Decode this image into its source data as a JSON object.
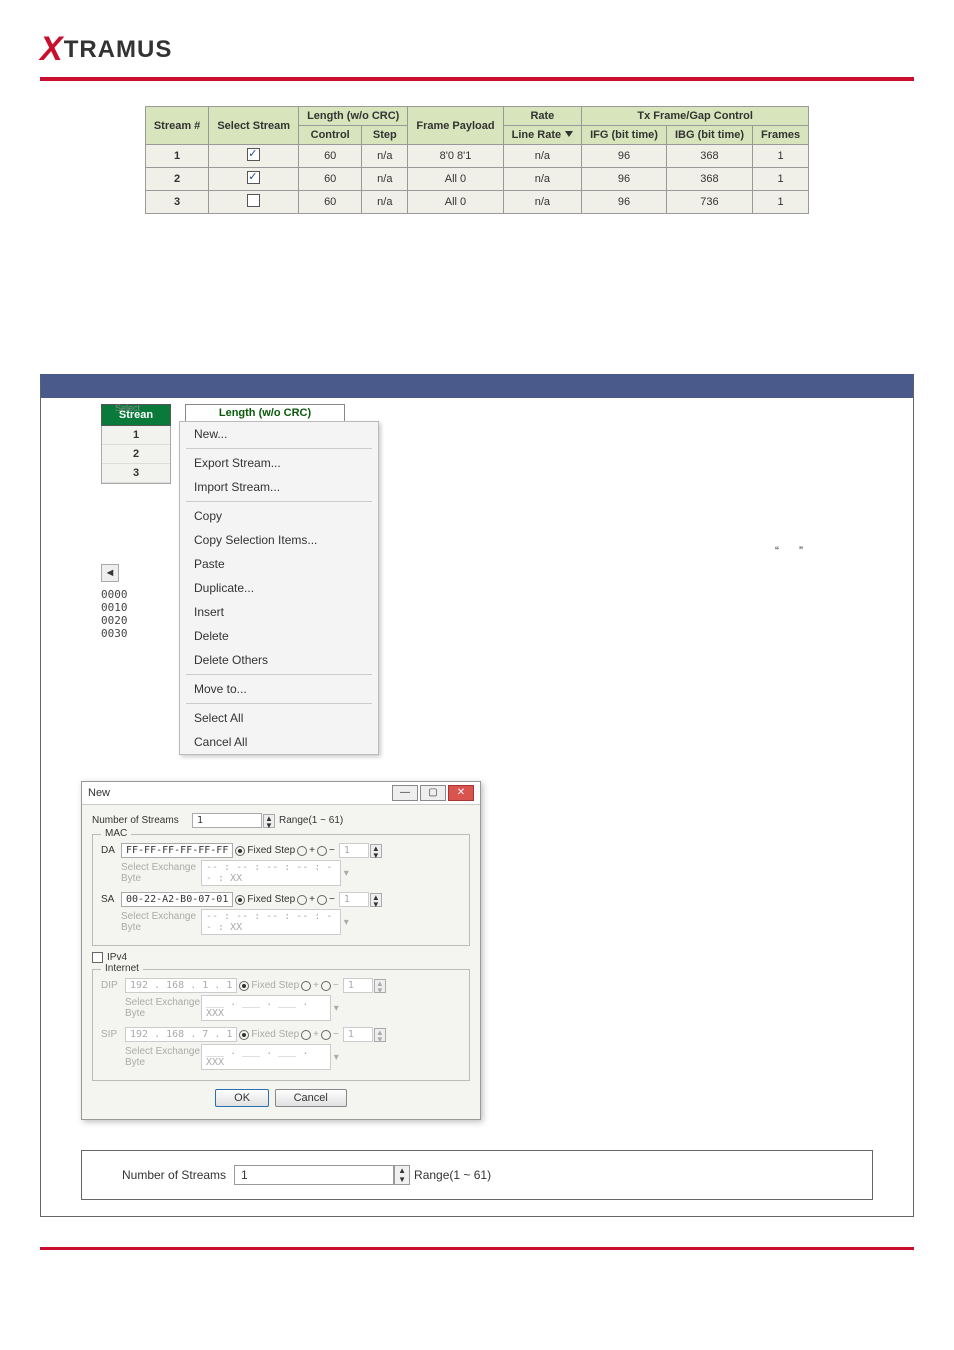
{
  "logo": {
    "x": "X",
    "rest": "TRAMUS"
  },
  "stream_table": {
    "headers": {
      "stream_no": "Stream #",
      "select_stream": "Select Stream",
      "length_group": "Length (w/o CRC)",
      "control": "Control",
      "step": "Step",
      "frame_payload": "Frame Payload",
      "rate": "Rate",
      "line_rate": "Line Rate",
      "tx_group": "Tx Frame/Gap Control",
      "ifg": "IFG (bit time)",
      "ibg": "IBG (bit time)",
      "frames": "Frames"
    },
    "rows": [
      {
        "num": "1",
        "checked": true,
        "control": "60",
        "step": "n/a",
        "payload": "8'0 8'1",
        "rate": "n/a",
        "ifg": "96",
        "ibg": "368",
        "frames": "1"
      },
      {
        "num": "2",
        "checked": true,
        "control": "60",
        "step": "n/a",
        "payload": "All 0",
        "rate": "n/a",
        "ifg": "96",
        "ibg": "368",
        "frames": "1"
      },
      {
        "num": "3",
        "checked": false,
        "control": "60",
        "step": "n/a",
        "payload": "All 0",
        "rate": "n/a",
        "ifg": "96",
        "ibg": "736",
        "frames": "1"
      }
    ]
  },
  "context_panel": {
    "stream_header": "Strean",
    "partial_header": "Length (w/o CRC)",
    "nums": [
      "1",
      "2",
      "3"
    ],
    "addrs": [
      "0000",
      "0010",
      "0020",
      "0030"
    ],
    "menu": {
      "new": "New...",
      "export": "Export Stream...",
      "import": "Import Stream...",
      "copy": "Copy",
      "copy_sel": "Copy Selection Items...",
      "paste": "Paste",
      "duplicate": "Duplicate...",
      "insert": "Insert",
      "delete": "Delete",
      "delete_others": "Delete Others",
      "move_to": "Move to...",
      "select_all": "Select All",
      "cancel_all": "Cancel All"
    },
    "note_quote_open": "“",
    "note_quote_close": "”"
  },
  "new_dialog": {
    "title": "New",
    "num_streams_label": "Number of Streams",
    "num_streams_value": "1",
    "range": "Range(1 ~ 61)",
    "mac_label": "MAC",
    "da_label": "DA",
    "da_value": "FF-FF-FF-FF-FF-FF",
    "fixed": "Fixed",
    "step": "Step",
    "one": "1",
    "sel_ex": "Select Exchange Byte",
    "mask_mac": "-- : -- : -- : -- : -- : XX",
    "sa_label": "SA",
    "sa_value": "00-22-A2-B0-07-01",
    "ipv4_label": "IPv4",
    "internet_label": "Internet",
    "dip_label": "DIP",
    "dip_value": "192 . 168 .  1  .  1",
    "mask_ip": "___ . ___ . ___ . XXX",
    "sip_label": "SIP",
    "sip_value": "192 . 168 .  7  .  1",
    "ok": "OK",
    "cancel": "Cancel"
  },
  "num_streams_bar": {
    "label": "Number of Streams",
    "value": "1",
    "range": "Range(1 ~ 61)"
  }
}
